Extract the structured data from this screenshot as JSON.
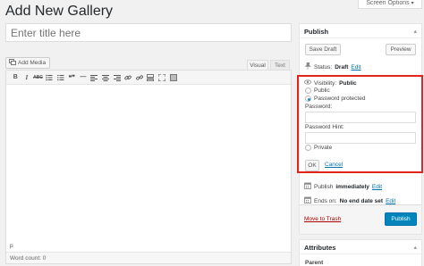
{
  "header": {
    "page_title": "Add New Gallery",
    "screen_options": "Screen Options"
  },
  "title_field": {
    "placeholder": "Enter title here"
  },
  "editor": {
    "add_media": "Add Media",
    "tabs": [
      "Visual",
      "Text"
    ],
    "toolbar_icons": [
      "bold-icon",
      "italic-icon",
      "strikethrough-icon",
      "bullet-list-icon",
      "numbered-list-icon",
      "blockquote-icon",
      "horizontal-rule-icon",
      "align-left-icon",
      "align-center-icon",
      "align-right-icon",
      "link-icon",
      "unlink-icon",
      "read-more-icon",
      "fullscreen-icon",
      "toolbar-toggle-icon"
    ],
    "toolbar_labels": {
      "bold": "B",
      "italic": "I",
      "strike": "ABC",
      "quote": "❝❞",
      "hr": "—"
    },
    "path": "p",
    "word_count": "Word count: 0"
  },
  "publish_box": {
    "title": "Publish",
    "save_draft": "Save Draft",
    "preview": "Preview",
    "status_label": "Status:",
    "status_value": "Draft",
    "edit": "Edit",
    "visibility_label": "Visibility:",
    "visibility_value": "Public",
    "options": [
      {
        "label": "Public",
        "checked": false
      },
      {
        "label": "Password protected",
        "checked": true
      },
      {
        "label": "Private",
        "checked": false
      }
    ],
    "password_label": "Password:",
    "password_hint_label": "Password Hint:",
    "ok": "OK",
    "cancel": "Cancel",
    "publish_immediately_label": "Publish",
    "publish_immediately_value": "immediately",
    "ends_on_label": "Ends on:",
    "ends_on_value": "No end date set",
    "move_to_trash": "Move to Trash",
    "publish_button": "Publish"
  },
  "attributes_box": {
    "title": "Attributes",
    "parent_label": "Parent"
  },
  "colors": {
    "accent": "#0085ba",
    "link": "#0073aa",
    "highlight": "#e2261c",
    "trash": "#a00000"
  }
}
